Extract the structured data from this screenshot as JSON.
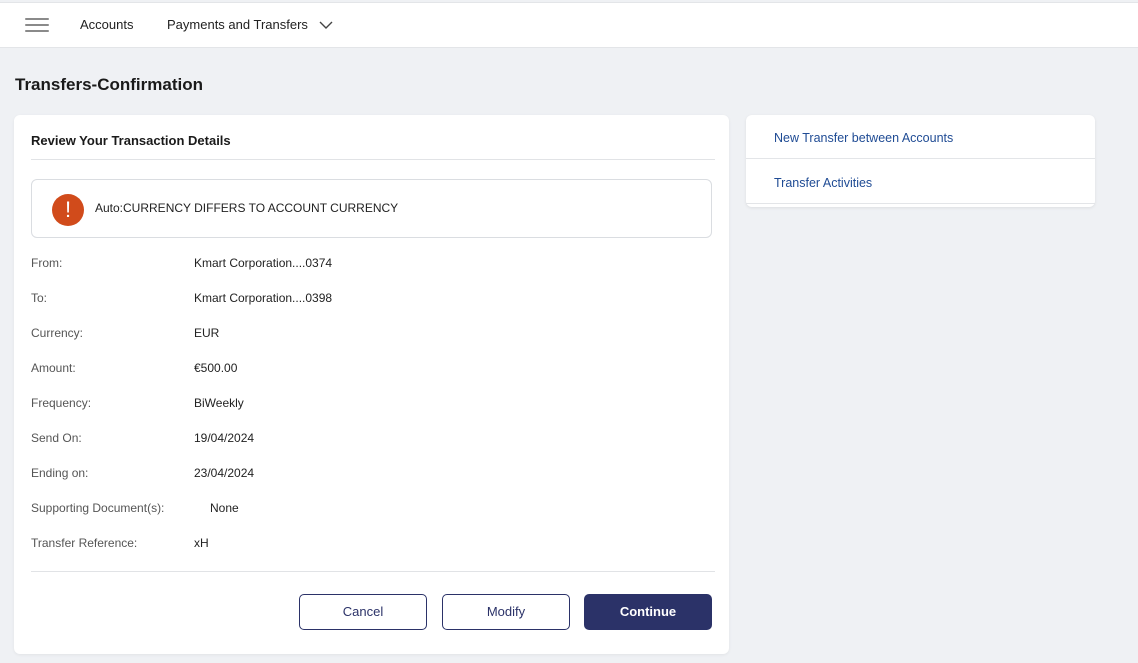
{
  "nav": {
    "items": [
      {
        "label": "Accounts"
      },
      {
        "label": "Payments and Transfers"
      }
    ]
  },
  "page": {
    "title": "Transfers-Confirmation"
  },
  "review": {
    "title": "Review Your Transaction Details",
    "alert_text": "Auto:CURRENCY DIFFERS TO ACCOUNT CURRENCY",
    "rows": [
      {
        "label": "From:",
        "value": "Kmart Corporation....0374"
      },
      {
        "label": "To:",
        "value": "Kmart Corporation....0398"
      },
      {
        "label": "Currency:",
        "value": "EUR"
      },
      {
        "label": "Amount:",
        "value": "€500.00"
      },
      {
        "label": "Frequency:",
        "value": "BiWeekly"
      },
      {
        "label": "Send On:",
        "value": "19/04/2024"
      },
      {
        "label": "Ending on:",
        "value": "23/04/2024"
      },
      {
        "label": "Supporting Document(s):",
        "value": "None"
      },
      {
        "label": "Transfer Reference:",
        "value": "xH"
      }
    ],
    "buttons": {
      "cancel": "Cancel",
      "modify": "Modify",
      "continue": "Continue"
    }
  },
  "side": {
    "links": [
      {
        "label": "New Transfer between Accounts"
      },
      {
        "label": "Transfer Activities"
      }
    ]
  },
  "icons": {
    "menu": "hamburger-menu-icon",
    "chevron": "chevron-down-icon",
    "alert": "exclamation-icon"
  },
  "colors": {
    "primary": "#2b3268",
    "link": "#1f4b94",
    "alert": "#d14b1b",
    "background": "#eff1f4"
  }
}
